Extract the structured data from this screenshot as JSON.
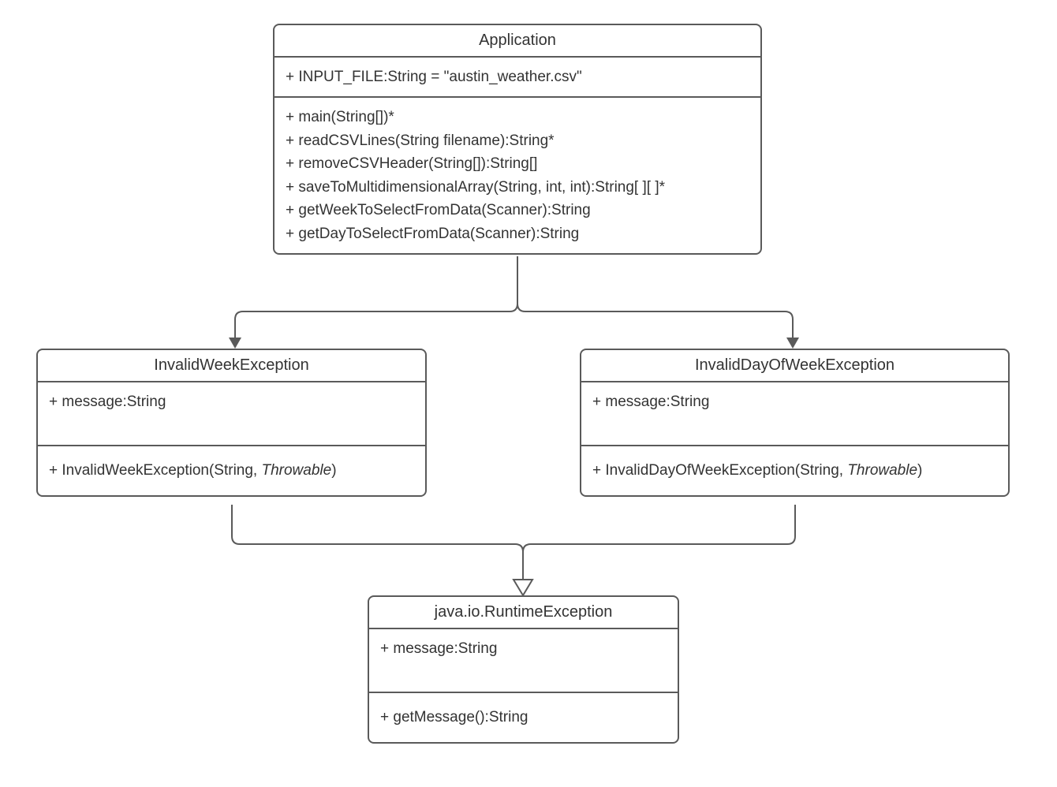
{
  "classes": {
    "application": {
      "name": "Application",
      "attributes": [
        "+ INPUT_FILE:String = \"austin_weather.csv\""
      ],
      "methods": [
        "+ main(String[])*",
        "+ readCSVLines(String filename):String*",
        "+ removeCSVHeader(String[]):String[]",
        "+ saveToMultidimensionalArray(String, int, int):String[ ][ ]*",
        "+ getWeekToSelectFromData(Scanner):String",
        "+ getDayToSelectFromData(Scanner):String"
      ]
    },
    "invalidWeek": {
      "name": "InvalidWeekException",
      "attributes": [
        "+ message:String"
      ],
      "methodPrefix": "+ InvalidWeekException(String, ",
      "methodItalic": "Throwable",
      "methodSuffix": ")"
    },
    "invalidDay": {
      "name": "InvalidDayOfWeekException",
      "attributes": [
        "+ message:String"
      ],
      "methodPrefix": "+ InvalidDayOfWeekException(String, ",
      "methodItalic": "Throwable",
      "methodSuffix": ")"
    },
    "runtime": {
      "name": "java.io.RuntimeException",
      "attributes": [
        "+ message:String"
      ],
      "methods": [
        "+ getMessage():String"
      ]
    }
  }
}
